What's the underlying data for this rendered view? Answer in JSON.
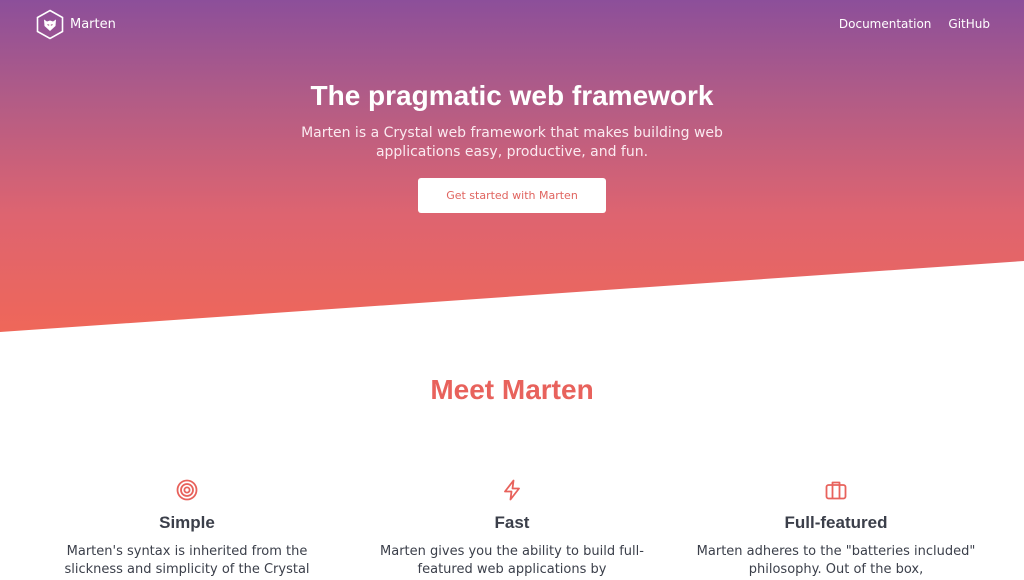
{
  "nav": {
    "brand": "Marten",
    "links": [
      "Documentation",
      "GitHub"
    ]
  },
  "hero": {
    "title": "The pragmatic web framework",
    "subtitle": "Marten is a Crystal web framework that makes building web applications easy, productive, and fun.",
    "cta": "Get started with Marten"
  },
  "section": {
    "title": "Meet Marten"
  },
  "features": [
    {
      "icon": "target-icon",
      "title": "Simple",
      "text": "Marten's syntax is inherited from the slickness and simplicity of the Crystal"
    },
    {
      "icon": "lightning-icon",
      "title": "Fast",
      "text": "Marten gives you the ability to build full-featured web applications by"
    },
    {
      "icon": "briefcase-icon",
      "title": "Full-featured",
      "text": "Marten adheres to the \"batteries included\" philosophy. Out of the box,"
    }
  ],
  "colors": {
    "gradient_top": "#8c4f9a",
    "gradient_bottom": "#ef6759",
    "accent": "#e8625c"
  }
}
